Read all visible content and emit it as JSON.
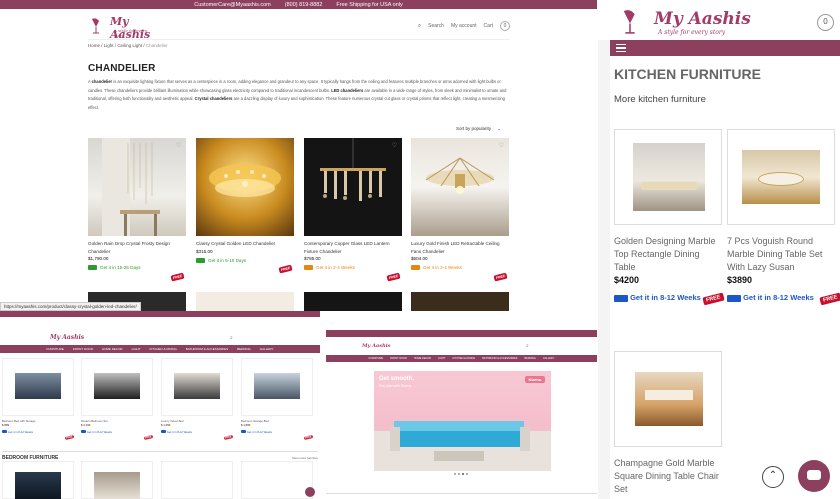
{
  "colors": {
    "brand": "#8d3f5e",
    "logo": "#a33b68",
    "sale_badge": "#c8102e",
    "ship_green": "#2c9a2c",
    "ship_orange": "#e08a12",
    "ship_blue": "#1c57c8"
  },
  "main": {
    "topbar": {
      "email": "CustomerCare@Myaashis.com",
      "phone": "(800) 819-8882",
      "shipping": "Free Shipping for USA only"
    },
    "logo": {
      "name": "My Aashis",
      "tagline": "A style for every story"
    },
    "header": {
      "search": "Search",
      "account": "My account",
      "cart": "Cart",
      "cart_count": "0"
    },
    "breadcrumb": [
      "Home",
      "Light",
      "Ceiling Light",
      "Chandelier"
    ],
    "title": "CHANDELIER",
    "desc_part1": "A ",
    "desc_bold1": "chandelier",
    "desc_part2": " is an exquisite lighting fixture that serves as a centerpiece in a room, adding elegance and grandeur to any space. It typically hangs from the ceiling and features multiple branches or arms adorned with light bulbs or candles. These chandeliers provide brilliant illumination while showcasing glass electricity compared to traditional incandescent bulbs. ",
    "desc_bold2": "LED chandeliers",
    "desc_part3": " are available in a wide range of styles, from sleek and minimalist to ornate and traditional, offering both functionality and aesthetic appeal. ",
    "desc_bold3": "Crystal chandeliers",
    "desc_part4": " are a dazzling display of luxury and sophistication. These feature numerous crystal cut glass or crystal prisms that reflect light, creating a mesmerizing effect.",
    "sort": "Sort by popularity",
    "products": [
      {
        "name": "Golden Rain Drop Crystal Frosty Design Chandelier",
        "price": "$1,790.00",
        "ship": "Get it in 15-25 Days",
        "ship_color": "green",
        "badge": "FREE"
      },
      {
        "name": "Classy Crystal Golden LED Chandelier",
        "price": "$315.00",
        "ship": "Get it in 5-10 Days",
        "ship_color": "green",
        "badge": "FREE"
      },
      {
        "name": "Contemporary Copper Glass LED Lantern Fixture Chandelier",
        "price": "$785.00",
        "ship": "Get it in 2-4 Weeks",
        "ship_color": "orange",
        "badge": "FREE"
      },
      {
        "name": "Luxury Gold Finish LED Retractable Ceiling Fans Chandelier",
        "price": "$604.00",
        "ship": "Get it in 2-4 Weeks",
        "ship_color": "orange",
        "badge": "FREE"
      }
    ]
  },
  "status_url": "https://myaashis.com/product/classy-crystal-golden-led-chandelier/",
  "mobile": {
    "logo": {
      "name": "My Aashis",
      "tagline": "A style for every story"
    },
    "cart_count": "0",
    "title": "KITCHEN FURNITURE",
    "subtitle": "More kitchen furniture",
    "products": [
      {
        "name": "Golden Designing Marble Top Rectangle Dining Table",
        "price": "$4200",
        "ship": "Get it in 8-12 Weeks",
        "badge": "FREE"
      },
      {
        "name": "7 Pcs Voguish Round Marble Dining Table Set With Lazy Susan",
        "price": "$3890",
        "ship": "Get it in 8-12 Weeks",
        "badge": "FREE"
      },
      {
        "name": "Champagne Gold Marble Square Dining Table Chair Set",
        "price": "",
        "ship": "",
        "badge": ""
      }
    ]
  },
  "left_shot": {
    "logo": "My Aashis",
    "nav": [
      "FURNITURE",
      "FRONT DOOR",
      "HOME DECOR",
      "LIGHT",
      "KITCHEN & DINING",
      "BATHROOM & ACCESSORIES",
      "BEDDING",
      "GALLERY"
    ],
    "section": "BEDROOM FURNITURE",
    "section_link": "View more furniture",
    "products": [
      {
        "name": "Bedroom Bed with Storage",
        "price": "$ 899",
        "ship": "Get it in 8-12 Weeks",
        "badge": "FREE"
      },
      {
        "name": "Modern Bedroom Set",
        "price": "$ 2,190",
        "ship": "Get it in 8-12 Weeks",
        "badge": "FREE"
      },
      {
        "name": "Luxury Velvet Bed",
        "price": "$ 1,450",
        "ship": "Get it in 8-12 Weeks",
        "badge": "FREE"
      },
      {
        "name": "Bedroom Storage Bed",
        "price": "$ 1,680",
        "ship": "Get it in 8-12 Weeks",
        "badge": "FREE"
      }
    ]
  },
  "right_shot": {
    "logo": "My Aashis",
    "nav": [
      "FURNITURE",
      "FRONT DOOR",
      "HOME DECOR",
      "LIGHT",
      "KITCHEN & DINING",
      "BATHROOM & ACCESSORIES",
      "BEDDING",
      "GALLERY"
    ],
    "banner_heading": "Get smooth.",
    "banner_sub": "Pay later with Klarna.",
    "banner_brand": "Klarna."
  }
}
